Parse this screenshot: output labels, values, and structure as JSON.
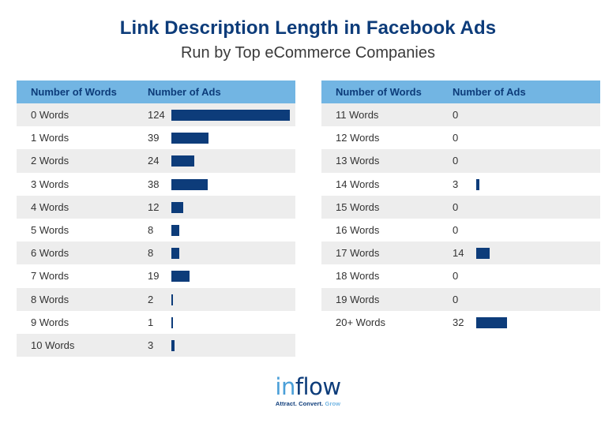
{
  "chart_data": {
    "type": "table",
    "title": "Link Description Length in Facebook Ads",
    "subtitle": "Run by Top eCommerce Companies",
    "columns": [
      "Number of Words",
      "Number of Ads"
    ],
    "bar_color": "#0d3c7a",
    "header_color": "#72b5e3",
    "max_value": 124,
    "left_table": [
      {
        "label": "0 Words",
        "value": 124
      },
      {
        "label": "1 Words",
        "value": 39
      },
      {
        "label": "2 Words",
        "value": 24
      },
      {
        "label": "3 Words",
        "value": 38
      },
      {
        "label": "4 Words",
        "value": 12
      },
      {
        "label": "5 Words",
        "value": 8
      },
      {
        "label": "6 Words",
        "value": 8
      },
      {
        "label": "7 Words",
        "value": 19
      },
      {
        "label": "8 Words",
        "value": 2
      },
      {
        "label": "9 Words",
        "value": 1
      },
      {
        "label": "10 Words",
        "value": 3
      }
    ],
    "right_table": [
      {
        "label": "11 Words",
        "value": 0
      },
      {
        "label": "12 Words",
        "value": 0
      },
      {
        "label": "13 Words",
        "value": 0
      },
      {
        "label": "14 Words",
        "value": 3
      },
      {
        "label": "15 Words",
        "value": 0
      },
      {
        "label": "16 Words",
        "value": 0
      },
      {
        "label": "17 Words",
        "value": 14
      },
      {
        "label": "18 Words",
        "value": 0
      },
      {
        "label": "19 Words",
        "value": 0
      },
      {
        "label": "20+ Words",
        "value": 32
      }
    ]
  },
  "logo": {
    "part1": "in",
    "part2": "flow",
    "tagline_main": "Attract. Convert.",
    "tagline_accent": "Grow"
  }
}
